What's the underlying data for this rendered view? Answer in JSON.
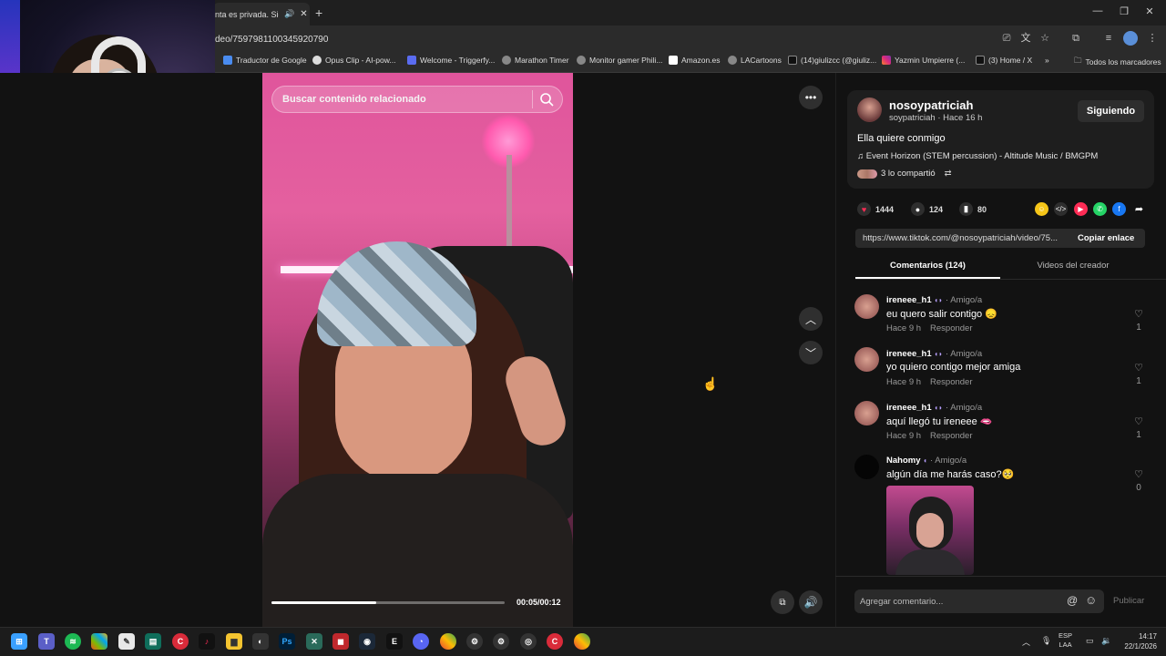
{
  "browser": {
    "tab_title": "nta es privada. Sigu",
    "url": "deo/7597981100345920790",
    "bookmarks": [
      "Traductor de Google",
      "Opus Clip - AI-pow...",
      "Welcome - Triggerfy...",
      "Marathon Timer",
      "Monitor gamer Phili...",
      "Amazon.es",
      "LACartoons",
      "(14)giulizcc (@giuliz...",
      "Yazmin Umpierre (...",
      "(3) Home / X",
      "Todos los marcadores"
    ]
  },
  "video": {
    "search_placeholder": "Buscar contenido relacionado",
    "progress_fraction": 0.45,
    "timecode": "00:05/00:12"
  },
  "post": {
    "display_name": "nosoypatriciah",
    "subline": "soypatriciah · Hace 16 h",
    "follow_label": "Siguiendo",
    "description": "Ella quiere conmigo",
    "music": "♫  Event Horizon (STEM percussion) - Altitude Music / BMGPM",
    "shared": "3 lo compartió",
    "likes": "1444",
    "comments_count": "124",
    "saves": "80",
    "link": "https://www.tiktok.com/@nosoypatriciah/video/75...",
    "copy_label": "Copiar enlace"
  },
  "tabs": {
    "comments": "Comentarios (124)",
    "videos": "Videos del creador"
  },
  "comments": [
    {
      "name": "ireneee_h1",
      "tag": "· Amigo/a",
      "text": "eu quero salir contigo 😞",
      "time": "Hace 9 h",
      "reply": "Responder",
      "likes": "1"
    },
    {
      "name": "ireneee_h1",
      "tag": "· Amigo/a",
      "text": "yo quiero contigo mejor amiga",
      "time": "Hace 9 h",
      "reply": "Responder",
      "likes": "1"
    },
    {
      "name": "ireneee_h1",
      "tag": "· Amigo/a",
      "text": "aquí llegó tu ireneee 🫦",
      "time": "Hace 9 h",
      "reply": "Responder",
      "likes": "1"
    },
    {
      "name": "Nahomy",
      "tag": "· Amigo/a",
      "text": "algún día me harás caso?🥺",
      "likes": "0"
    }
  ],
  "composer": {
    "placeholder": "Agregar comentario...",
    "publish": "Publicar"
  },
  "system": {
    "lang_line1": "ESP",
    "lang_line2": "LAA",
    "time": "14:17",
    "date": "22/1/2026"
  },
  "colors": {
    "accent_red": "#fe2c55",
    "panel_bg": "#121212",
    "card_bg": "#1e1e1e"
  }
}
